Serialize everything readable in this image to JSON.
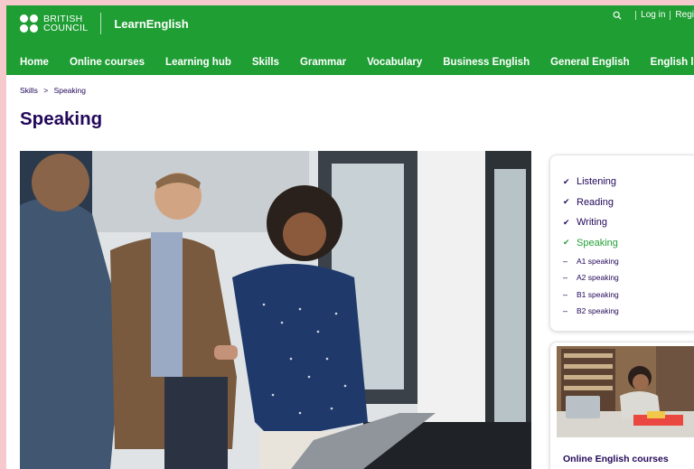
{
  "brand": {
    "line1": "BRITISH",
    "line2": "COUNCIL",
    "site_name": "LearnEnglish"
  },
  "utility": {
    "login": "Log in",
    "register": "Regi"
  },
  "nav": [
    "Home",
    "Online courses",
    "Learning hub",
    "Skills",
    "Grammar",
    "Vocabulary",
    "Business English",
    "General English",
    "English levels"
  ],
  "breadcrumb": {
    "parent": "Skills",
    "separator": ">",
    "current": "Speaking"
  },
  "page_title": "Speaking",
  "sidebar": {
    "items": [
      {
        "label": "Listening",
        "marker": "✔"
      },
      {
        "label": "Reading",
        "marker": "✔"
      },
      {
        "label": "Writing",
        "marker": "✔"
      },
      {
        "label": "Speaking",
        "marker": "✔"
      },
      {
        "label": "A1 speaking",
        "marker": "–"
      },
      {
        "label": "A2 speaking",
        "marker": "–"
      },
      {
        "label": "B1 speaking",
        "marker": "–"
      },
      {
        "label": "B2 speaking",
        "marker": "–"
      }
    ]
  },
  "course_card": {
    "title": "Online English courses"
  },
  "colors": {
    "brand_green": "#23a136",
    "title_purple": "#23085a",
    "page_edge": "#f6c9cc"
  }
}
